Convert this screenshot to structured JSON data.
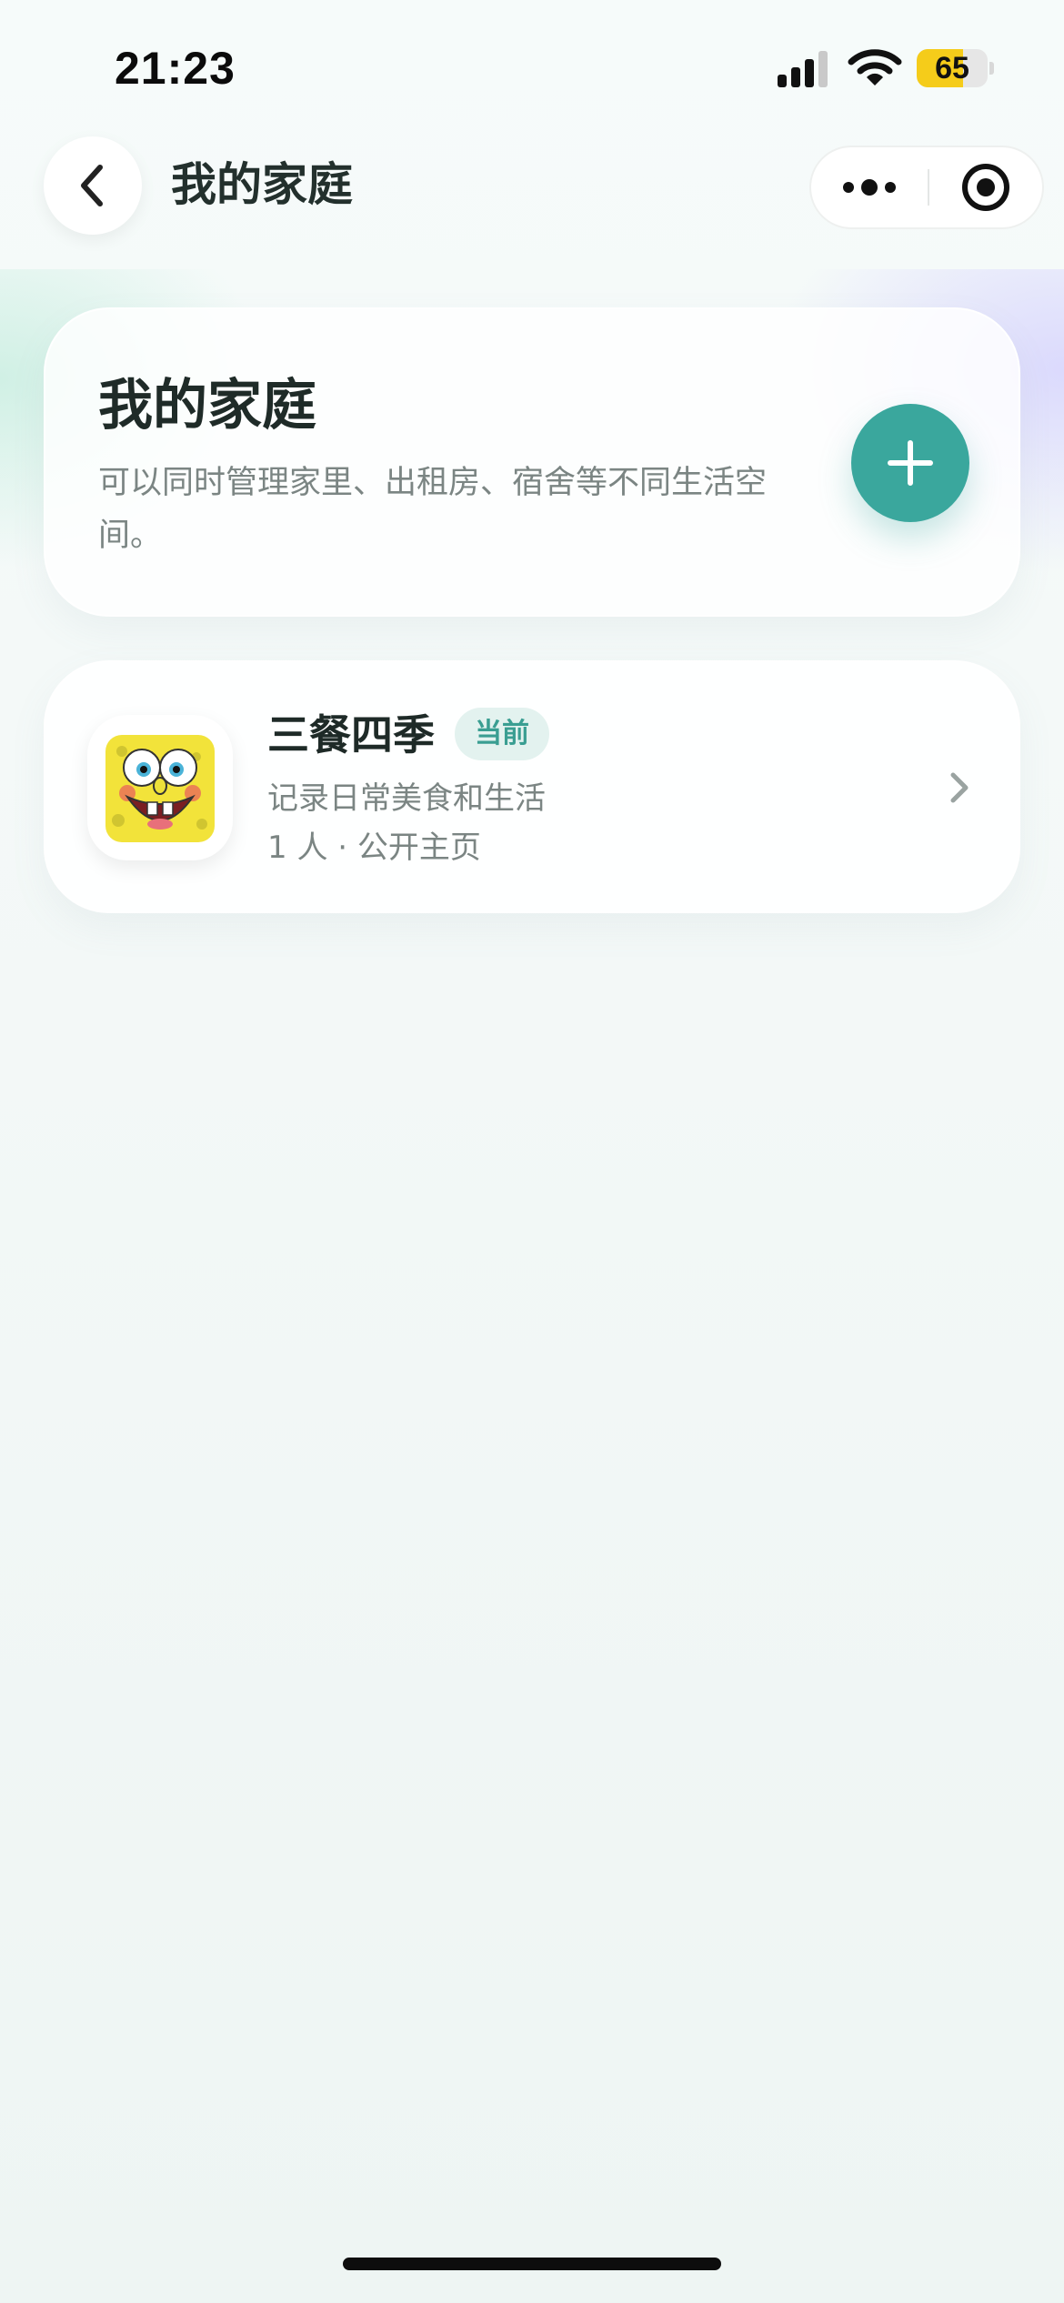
{
  "status_bar": {
    "time": "21:23",
    "battery_level": "65",
    "battery_fraction": 0.65,
    "signal_icon": "cellular-signal-icon",
    "wifi_icon": "wifi-icon"
  },
  "nav": {
    "title": "我的家庭",
    "back_icon": "chevron-left-icon",
    "more_icon": "more-dots-icon",
    "close_icon": "target-circle-icon"
  },
  "header_card": {
    "title": "我的家庭",
    "description": "可以同时管理家里、出租房、宿舍等不同生活空间。",
    "add_icon": "plus-icon"
  },
  "families": [
    {
      "name": "三餐四季",
      "badge": "当前",
      "description": "记录日常美食和生活",
      "meta": "1 人 · 公开主页",
      "avatar_icon": "spongebob-avatar"
    }
  ],
  "colors": {
    "accent": "#3aa79d",
    "badge_bg": "#e3f2ef",
    "badge_text": "#3a9e92",
    "battery": "#f5cc1a"
  }
}
